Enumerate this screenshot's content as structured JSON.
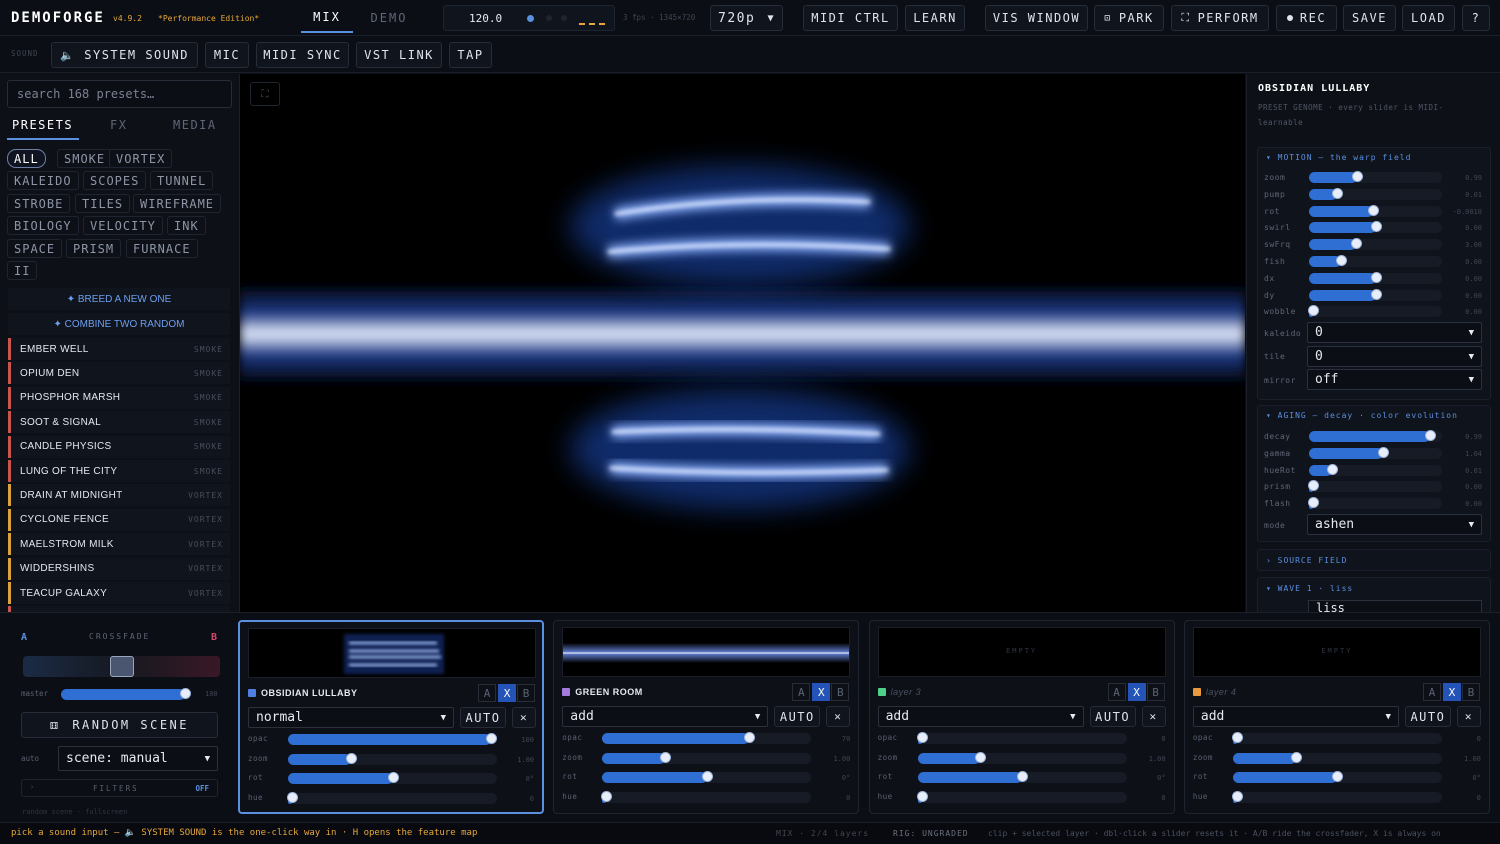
{
  "app": {
    "title": "DEMOFORGE",
    "version": "v4.9.2",
    "edition": "*Performance Edition*"
  },
  "tabs": [
    {
      "label": "MIX",
      "active": true
    },
    {
      "label": "DEMO",
      "active": false
    }
  ],
  "bpm": "120.0",
  "fps": "3 fps · 1345×720",
  "resolution": "720p",
  "toolbar": {
    "midi_ctrl": "MIDI CTRL",
    "learn": "LEARN",
    "vis_window": "VIS WINDOW",
    "park": "PARK",
    "perform": "PERFORM",
    "rec": "REC",
    "save": "SAVE",
    "load": "LOAD",
    "help": "?"
  },
  "sound": {
    "label": "SOUND",
    "system_sound": "SYSTEM SOUND",
    "mic": "MIC",
    "midi_sync": "MIDI SYNC",
    "vst_link": "VST LINK",
    "tap": "TAP"
  },
  "left": {
    "search_placeholder": "search 168 presets…",
    "tabs": [
      "PRESETS",
      "FX",
      "MEDIA"
    ],
    "chips": [
      "ALL",
      "SMOKE",
      "VORTEX",
      "KALEIDO",
      "SCOPES",
      "TUNNEL",
      "STROBE",
      "TILES",
      "WIREFRAME",
      "BIOLOGY",
      "VELOCITY",
      "INK",
      "SPACE",
      "PRISM",
      "FURNACE",
      "II"
    ],
    "breed": "✦ BREED A NEW ONE",
    "combine": "✦ COMBINE TWO RANDOM",
    "presets": [
      {
        "name": "EMBER WELL",
        "tag": "SMOKE"
      },
      {
        "name": "OPIUM DEN",
        "tag": "SMOKE"
      },
      {
        "name": "PHOSPHOR MARSH",
        "tag": "SMOKE"
      },
      {
        "name": "SOOT & SIGNAL",
        "tag": "SMOKE"
      },
      {
        "name": "CANDLE PHYSICS",
        "tag": "SMOKE"
      },
      {
        "name": "LUNG OF THE CITY",
        "tag": "SMOKE"
      },
      {
        "name": "DRAIN AT MIDNIGHT",
        "tag": "VORTEX"
      },
      {
        "name": "CYCLONE FENCE",
        "tag": "VORTEX"
      },
      {
        "name": "MAELSTROM MILK",
        "tag": "VORTEX"
      },
      {
        "name": "WIDDERSHINS",
        "tag": "VORTEX"
      },
      {
        "name": "TEACUP GALAXY",
        "tag": "VORTEX"
      }
    ]
  },
  "right": {
    "title": "OBSIDIAN LULLABY",
    "subtitle": "PRESET GENOME · every slider is MIDI-learnable",
    "motion_header": "▾ MOTION — the warp field",
    "motion": [
      {
        "label": "zoom",
        "value": "0.99",
        "fill": 0.36
      },
      {
        "label": "pump",
        "value": "0.01",
        "fill": 0.21
      },
      {
        "label": "rot",
        "value": "-0.0010",
        "fill": 0.48
      },
      {
        "label": "swirl",
        "value": "0.00",
        "fill": 0.5
      },
      {
        "label": "swFrq",
        "value": "3.00",
        "fill": 0.35
      },
      {
        "label": "fish",
        "value": "0.00",
        "fill": 0.24
      },
      {
        "label": "dx",
        "value": "0.00",
        "fill": 0.5
      },
      {
        "label": "dy",
        "value": "0.00",
        "fill": 0.5
      },
      {
        "label": "wobble",
        "value": "0.00",
        "fill": 0.03
      }
    ],
    "kaleido_label": "kaleido",
    "kaleido_value": "0",
    "tile_label": "tile",
    "tile_value": "0",
    "mirror_label": "mirror",
    "mirror_value": "off",
    "aging_header": "▾ AGING — decay · color evolution",
    "aging": [
      {
        "label": "decay",
        "value": "0.99",
        "fill": 0.91
      },
      {
        "label": "gamma",
        "value": "1.04",
        "fill": 0.56
      },
      {
        "label": "hueRot",
        "value": "0.01",
        "fill": 0.17
      },
      {
        "label": "prism",
        "value": "0.00",
        "fill": 0.03
      },
      {
        "label": "flash",
        "value": "0.00",
        "fill": 0.03
      }
    ],
    "mode_label": "mode",
    "mode_value": "ashen",
    "source_header": "› SOURCE FIELD",
    "wave_header": "▾ WAVE 1 · liss",
    "wave_type_value": "liss"
  },
  "crossfade": {
    "a": "A",
    "b": "B",
    "label": "CROSSFADE",
    "position": 0.5,
    "master_label": "master",
    "master_value": "100",
    "master_fill": 0.95,
    "random_scene": "RANDOM SCENE",
    "auto_label": "auto",
    "scene_value": "scene: manual",
    "filters_label": "FILTERS",
    "filters_state": "OFF",
    "hint": "random scene · fullscreen"
  },
  "layers": [
    {
      "name": "OBSIDIAN LULLABY",
      "color": "#4f7fe0",
      "empty": false,
      "blend": "normal",
      "opac": {
        "value": "100",
        "fill": 0.97
      },
      "zoom": {
        "value": "1.00",
        "fill": 0.3
      },
      "rot": {
        "value": "0°",
        "fill": 0.5
      },
      "hue": {
        "value": "0",
        "fill": 0.02
      }
    },
    {
      "name": "GREEN ROOM",
      "color": "#a57cde",
      "empty": false,
      "blend": "add",
      "opac": {
        "value": "70",
        "fill": 0.7
      },
      "zoom": {
        "value": "1.00",
        "fill": 0.3
      },
      "rot": {
        "value": "0°",
        "fill": 0.5
      },
      "hue": {
        "value": "0",
        "fill": 0.02
      }
    },
    {
      "name": "layer 3",
      "color": "#4fd08a",
      "empty": true,
      "blend": "add",
      "opac": {
        "value": "0",
        "fill": 0.02
      },
      "zoom": {
        "value": "1.00",
        "fill": 0.3
      },
      "rot": {
        "value": "0°",
        "fill": 0.5
      },
      "hue": {
        "value": "0",
        "fill": 0.02
      }
    },
    {
      "name": "layer 4",
      "color": "#e89a3c",
      "empty": true,
      "blend": "add",
      "opac": {
        "value": "0",
        "fill": 0.02
      },
      "zoom": {
        "value": "1.00",
        "fill": 0.3
      },
      "rot": {
        "value": "0°",
        "fill": 0.5
      },
      "hue": {
        "value": "0",
        "fill": 0.02
      }
    }
  ],
  "layer_labels": {
    "opac": "opac",
    "zoom": "zoom",
    "rot": "rot",
    "hue": "hue",
    "auto": "AUTO",
    "empty": "EMPTY",
    "seg_a": "A",
    "seg_x": "X",
    "seg_b": "B"
  },
  "status": {
    "left": "pick a sound input — 🔈 SYSTEM SOUND is the one-click way in · H opens the feature map",
    "mode": "MIX · 2/4 layers",
    "rig": "RIG: UNGRADED",
    "right": "clip + selected layer · dbl-click a slider resets it · A/B ride the crossfader, X is always on"
  }
}
